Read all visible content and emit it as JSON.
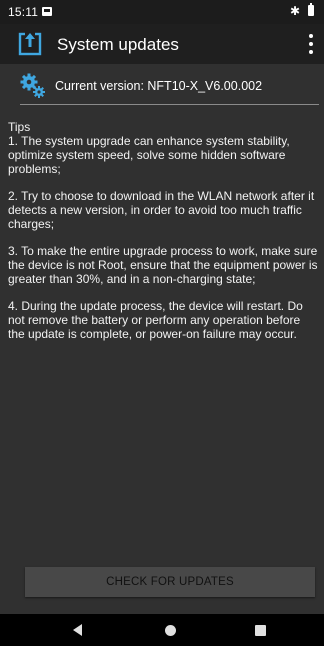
{
  "status_bar": {
    "time": "15:11",
    "bluetooth_icon": "bluetooth-icon",
    "battery_icon": "battery-icon"
  },
  "app_bar": {
    "title": "System updates",
    "app_icon": "upload-box-icon",
    "menu_icon": "overflow-menu-icon"
  },
  "version": {
    "icon": "gear-icon",
    "label": "Current version: NFT10-X_V6.00.002"
  },
  "tips": {
    "title": "Tips",
    "items": [
      "1. The system upgrade can enhance system stability, optimize system speed, solve some hidden software problems;",
      "2. Try to choose to download in the WLAN network after it detects a new version, in order to avoid too much traffic charges;",
      "3. To make the entire upgrade process to work, make sure the device is not Root, ensure that the equipment power is greater than 30%, and in a non-charging state;",
      "4. During the update process, the device will restart. Do not remove the battery or perform any operation before the update is complete, or power-on failure may occur."
    ]
  },
  "check_button": {
    "label": "CHECK FOR UPDATES"
  },
  "colors": {
    "accent": "#3fa7e0",
    "background": "#303030",
    "app_bar": "#1f1f1f"
  }
}
